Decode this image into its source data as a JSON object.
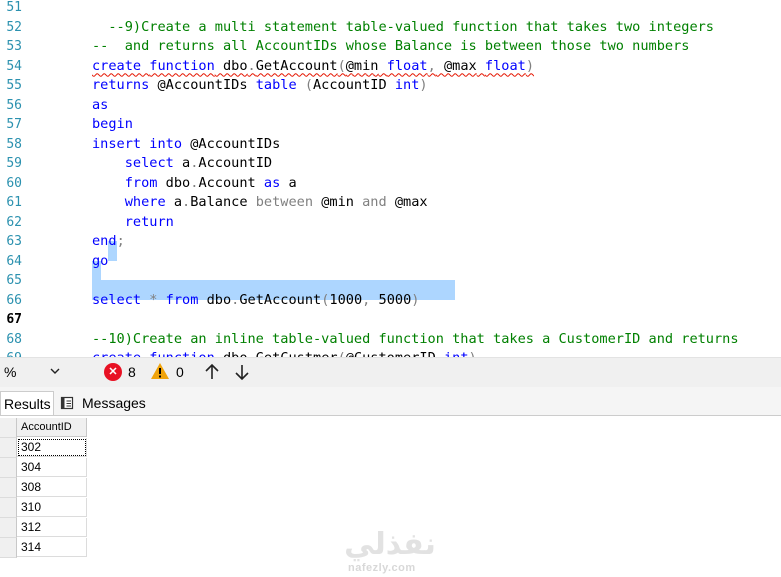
{
  "editor": {
    "lines": [
      {
        "n": "51",
        "tokens": []
      },
      {
        "n": "52",
        "tokens": [
          {
            "t": "  --9)Create a multi statement table-valued function that takes two integers",
            "c": "cm"
          }
        ]
      },
      {
        "n": "53",
        "tokens": [
          {
            "t": "--  and returns all AccountIDs whose Balance is between those two numbers",
            "c": "cm"
          }
        ]
      },
      {
        "n": "54",
        "tokens": [
          {
            "t": "create",
            "c": "kw",
            "sq": true
          },
          {
            "t": " ",
            "c": "sp",
            "sq": true
          },
          {
            "t": "function",
            "c": "kw",
            "sq": true
          },
          {
            "t": " dbo",
            "c": "id",
            "sq": true
          },
          {
            "t": ".",
            "c": "op",
            "sq": true
          },
          {
            "t": "GetAccount",
            "c": "id",
            "sq": true
          },
          {
            "t": "(",
            "c": "op",
            "sq": true
          },
          {
            "t": "@min",
            "c": "id",
            "sq": true
          },
          {
            "t": " ",
            "c": "sp",
            "sq": true
          },
          {
            "t": "float",
            "c": "kw",
            "sq": true
          },
          {
            "t": ",",
            "c": "op",
            "sq": true
          },
          {
            "t": " @max",
            "c": "id",
            "sq": true
          },
          {
            "t": " ",
            "c": "sp",
            "sq": true
          },
          {
            "t": "float",
            "c": "kw",
            "sq": true
          },
          {
            "t": ")",
            "c": "op",
            "sq": true
          }
        ]
      },
      {
        "n": "55",
        "tokens": [
          {
            "t": "returns",
            "c": "kw"
          },
          {
            "t": " @AccountIDs ",
            "c": "id"
          },
          {
            "t": "table",
            "c": "kw"
          },
          {
            "t": " ",
            "c": "sp"
          },
          {
            "t": "(",
            "c": "op"
          },
          {
            "t": "AccountID ",
            "c": "id"
          },
          {
            "t": "int",
            "c": "kw"
          },
          {
            "t": ")",
            "c": "op"
          }
        ]
      },
      {
        "n": "56",
        "tokens": [
          {
            "t": "as",
            "c": "kw"
          }
        ]
      },
      {
        "n": "57",
        "tokens": [
          {
            "t": "begin",
            "c": "kw"
          }
        ]
      },
      {
        "n": "58",
        "tokens": [
          {
            "t": "insert",
            "c": "kw"
          },
          {
            "t": " ",
            "c": "sp"
          },
          {
            "t": "into",
            "c": "kw"
          },
          {
            "t": " @AccountIDs",
            "c": "id"
          }
        ]
      },
      {
        "n": "59",
        "tokens": [
          {
            "t": "    ",
            "c": "sp"
          },
          {
            "t": "select",
            "c": "kw"
          },
          {
            "t": " a",
            "c": "id"
          },
          {
            "t": ".",
            "c": "op"
          },
          {
            "t": "AccountID",
            "c": "id"
          }
        ]
      },
      {
        "n": "60",
        "tokens": [
          {
            "t": "    ",
            "c": "sp"
          },
          {
            "t": "from",
            "c": "kw"
          },
          {
            "t": " dbo",
            "c": "id"
          },
          {
            "t": ".",
            "c": "op"
          },
          {
            "t": "Account ",
            "c": "id"
          },
          {
            "t": "as",
            "c": "kw"
          },
          {
            "t": " a",
            "c": "id"
          }
        ]
      },
      {
        "n": "61",
        "tokens": [
          {
            "t": "    ",
            "c": "sp"
          },
          {
            "t": "where",
            "c": "kw"
          },
          {
            "t": " a",
            "c": "id"
          },
          {
            "t": ".",
            "c": "op"
          },
          {
            "t": "Balance ",
            "c": "id"
          },
          {
            "t": "between",
            "c": "op"
          },
          {
            "t": " @min ",
            "c": "id"
          },
          {
            "t": "and",
            "c": "op"
          },
          {
            "t": " @max",
            "c": "id"
          }
        ]
      },
      {
        "n": "62",
        "tokens": [
          {
            "t": "    ",
            "c": "sp"
          },
          {
            "t": "return",
            "c": "kw"
          }
        ]
      },
      {
        "n": "63",
        "tokens": [
          {
            "t": "end",
            "c": "kw"
          },
          {
            "t": ";",
            "c": "op"
          }
        ]
      },
      {
        "n": "64",
        "tokens": [
          {
            "t": "go",
            "c": "kw"
          }
        ]
      },
      {
        "n": "65",
        "tokens": []
      },
      {
        "n": "66",
        "tokens": [
          {
            "t": "select",
            "c": "kw"
          },
          {
            "t": " ",
            "c": "sp"
          },
          {
            "t": "*",
            "c": "op"
          },
          {
            "t": " ",
            "c": "sp"
          },
          {
            "t": "from",
            "c": "kw"
          },
          {
            "t": " dbo",
            "c": "id"
          },
          {
            "t": ".",
            "c": "op"
          },
          {
            "t": "GetAccount",
            "c": "id"
          },
          {
            "t": "(",
            "c": "op"
          },
          {
            "t": "1000",
            "c": "id"
          },
          {
            "t": ",",
            "c": "op"
          },
          {
            "t": " 5000",
            "c": "id"
          },
          {
            "t": ")",
            "c": "op"
          }
        ]
      },
      {
        "n": "67",
        "tokens": [],
        "current": true
      },
      {
        "n": "68",
        "tokens": [
          {
            "t": "--10)Create an inline table-valued function that takes a CustomerID and returns",
            "c": "cm"
          }
        ]
      },
      {
        "n": "69",
        "tokens": [
          {
            "t": "create",
            "c": "kw",
            "sq": true
          },
          {
            "t": " ",
            "c": "sp",
            "sq": true
          },
          {
            "t": "function",
            "c": "kw",
            "sq": true
          },
          {
            "t": " dbo",
            "c": "id",
            "sq": true
          },
          {
            "t": ".",
            "c": "op",
            "sq": true
          },
          {
            "t": "GetCustmer",
            "c": "id",
            "sq": true
          },
          {
            "t": "(",
            "c": "op",
            "sq": true
          },
          {
            "t": "@CustomerID ",
            "c": "id",
            "sq": true
          },
          {
            "t": "int",
            "c": "kw",
            "sq": true
          },
          {
            "t": ")",
            "c": "op",
            "sq": true
          }
        ]
      }
    ]
  },
  "status": {
    "zoom": "%",
    "errors": "8",
    "warnings": "0"
  },
  "tabs": {
    "results": "Results",
    "messages": "Messages"
  },
  "results": {
    "column": "AccountID",
    "rows": [
      "302",
      "304",
      "308",
      "310",
      "312",
      "314"
    ]
  },
  "watermark": {
    "logo_text": "نفذلي",
    "site": "nafezly.com"
  },
  "colors": {
    "keyword": "#0000ff",
    "comment": "#008000",
    "operator": "#808080",
    "line_number": "#2b91af",
    "selection": "#add6ff",
    "error": "#e81123",
    "warning": "#f0a30a"
  }
}
